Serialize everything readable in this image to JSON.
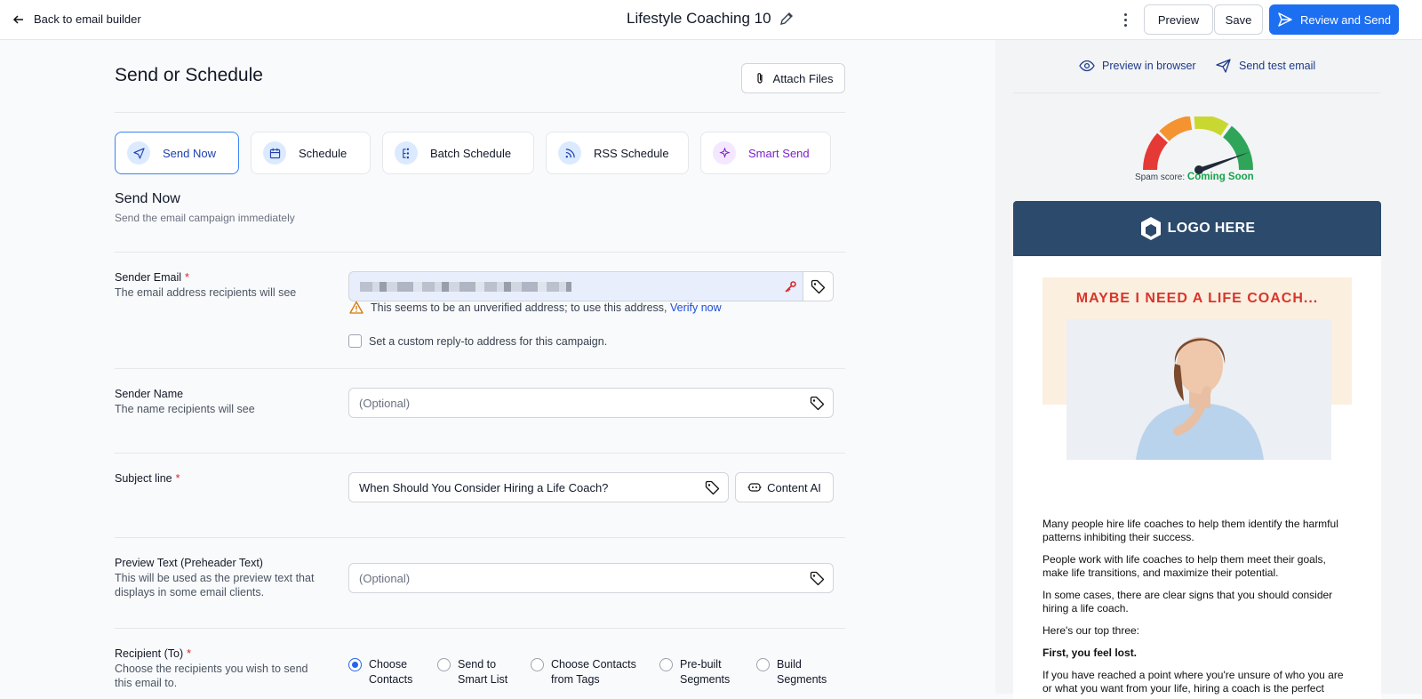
{
  "topbar": {
    "back_label": "Back to email builder",
    "title": "Lifestyle Coaching 10",
    "preview_label": "Preview",
    "save_label": "Save",
    "review_label": "Review and Send",
    "accent": "#1d6ff2"
  },
  "main": {
    "heading": "Send or Schedule",
    "attach_label": "Attach Files",
    "tabs": [
      {
        "label": "Send Now",
        "icon": "send-icon",
        "active": true
      },
      {
        "label": "Schedule",
        "icon": "calendar-icon"
      },
      {
        "label": "Batch Schedule",
        "icon": "batch-icon"
      },
      {
        "label": "RSS Schedule",
        "icon": "rss-icon"
      },
      {
        "label": "Smart Send",
        "icon": "sparkle-icon"
      }
    ],
    "section_title": "Send Now",
    "section_subtitle": "Send the email campaign immediately",
    "sender_email": {
      "label": "Sender Email",
      "required": "*",
      "description": "The email address recipients will see",
      "warning": "This seems to be an unverified address; to use this address,",
      "verify_link": "Verify now",
      "custom_reply": "Set a custom reply-to address for this campaign."
    },
    "sender_name": {
      "label": "Sender Name",
      "description": "The name recipients will see",
      "placeholder": "(Optional)"
    },
    "subject": {
      "label": "Subject line",
      "required": "*",
      "value": "When Should You Consider Hiring a Life Coach?",
      "content_ai_label": "Content AI"
    },
    "preview_text": {
      "label": "Preview Text (Preheader Text)",
      "description_1": "This will be used as the preview text that",
      "description_2": "displays in some email clients.",
      "placeholder": "(Optional)"
    },
    "recipient": {
      "label": "Recipient (To)",
      "required": "*",
      "description_1": "Choose the recipients you wish to send",
      "description_2": "this email to.",
      "options": [
        {
          "line1": "Choose",
          "line2": "Contacts",
          "selected": true
        },
        {
          "line1": "Send to",
          "line2": "Smart List"
        },
        {
          "line1": "Choose Contacts",
          "line2": "from Tags"
        },
        {
          "line1": "Pre-built",
          "line2": "Segments"
        },
        {
          "line1": "Build",
          "line2": "Segments"
        }
      ]
    }
  },
  "preview_panel": {
    "preview_browser": "Preview in browser",
    "send_test": "Send test email",
    "spam_label": "Spam score:",
    "spam_value": "Coming Soon",
    "email": {
      "logo_text": "LOGO HERE",
      "hero_title": "MAYBE I NEED A LIFE COACH...",
      "paragraphs": [
        "Many people hire life coaches to help them identify the harmful patterns inhibiting their success.",
        "People work with life coaches to help them meet their goals, make life transitions, and maximize their potential.",
        "In some cases, there are clear signs that you should consider hiring a life coach.",
        "Here's our top three:",
        "First, you feel lost.",
        "If you have reached a point where you're unsure of who you are or what you want from your life, hiring a coach is the perfect"
      ]
    }
  }
}
